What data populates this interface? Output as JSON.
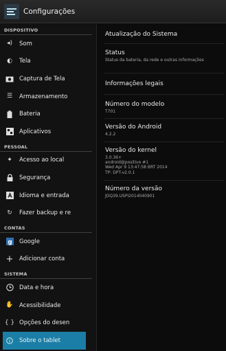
{
  "app": {
    "title": "Configurações"
  },
  "sections": {
    "dispositivo": "DISPOSITIVO",
    "pessoal": "PESSOAL",
    "contas": "CONTAS",
    "sistema": "SISTEMA"
  },
  "menu": {
    "som": "Som",
    "tela": "Tela",
    "captura": "Captura de Tela",
    "armazenamento": "Armazenamento",
    "bateria": "Bateria",
    "aplicativos": "Aplicativos",
    "acesso": "Acesso ao local",
    "seguranca": "Segurança",
    "idioma": "Idioma e entrada",
    "backup": "Fazer backup e re",
    "google": "Google",
    "adicionar": "Adicionar conta",
    "data": "Data e hora",
    "acessibilidade": "Acessibilidade",
    "opcoes": "Opções do desen",
    "sobre": "Sobre o tablet"
  },
  "detail": {
    "atualizacao": "Atualização do Sistema",
    "status_title": "Status",
    "status_sub": "Status da bateria, da rede e outras informações",
    "legais": "Informações legais",
    "modelo_title": "Número do modelo",
    "modelo_value": "T701",
    "android_title": "Versão do Android",
    "android_value": "4.2.2",
    "kernel_title": "Versão do kernel",
    "kernel_line1": "3.0.36+",
    "kernel_line2": "android@positivo #1",
    "kernel_line3": "Wed Apr 9 13:47:58 BRT 2014",
    "kernel_line4": "TP: DPT-v2.0.1",
    "build_title": "Número da versão",
    "build_value": "JDQ39.USPI2014040901"
  },
  "colors": {
    "accent": "#1b7ea6",
    "background": "#0c0c0c"
  }
}
